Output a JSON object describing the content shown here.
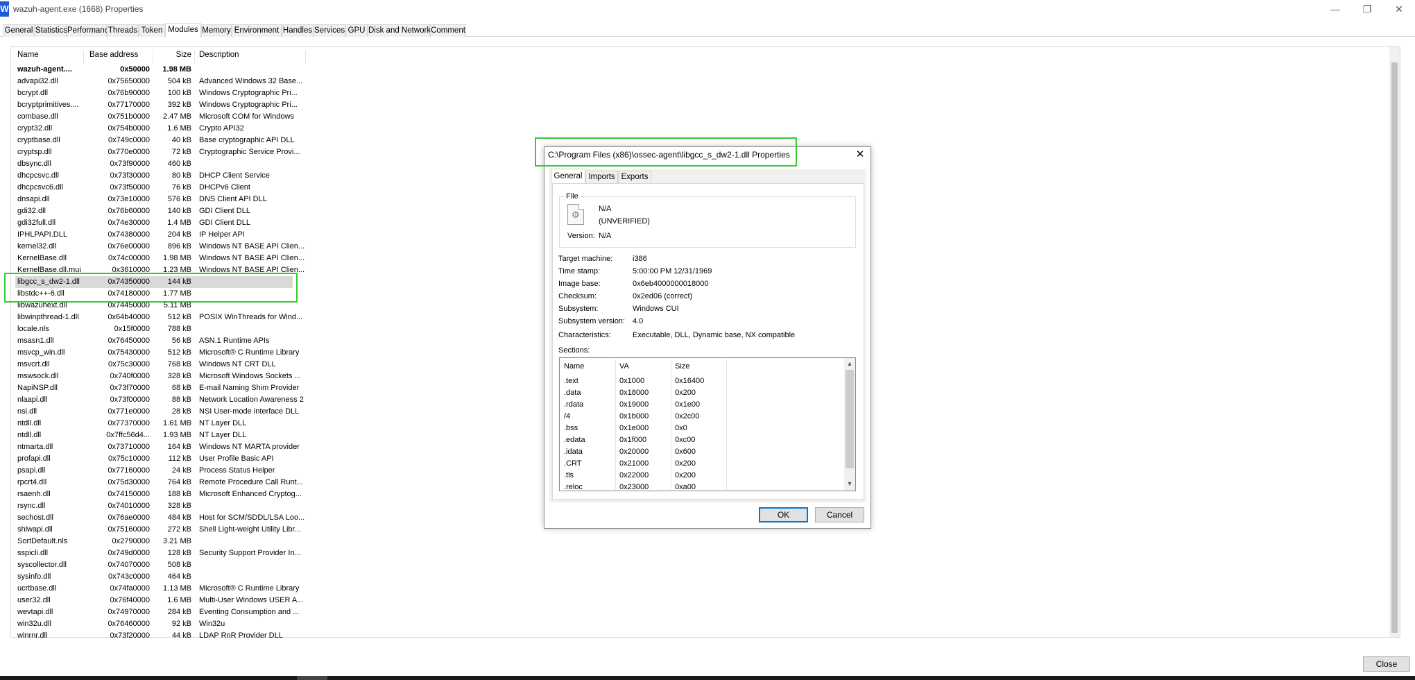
{
  "window": {
    "app_icon_letter": "W",
    "title": "wazuh-agent.exe (1668) Properties",
    "close_button": "Close"
  },
  "tabs": [
    "General",
    "Statistics",
    "Performance",
    "Threads",
    "Token",
    "Modules",
    "Memory",
    "Environment",
    "Handles",
    "Services",
    "GPU",
    "Disk and Network",
    "Comment"
  ],
  "active_tab": "Modules",
  "modules": {
    "columns": {
      "name": "Name",
      "base": "Base address",
      "size": "Size",
      "desc": "Description"
    },
    "rows": [
      {
        "name": "wazuh-agent....",
        "base": "0x50000",
        "size": "1.98 MB",
        "desc": "",
        "bold": true
      },
      {
        "name": "advapi32.dll",
        "base": "0x75650000",
        "size": "504 kB",
        "desc": "Advanced Windows 32 Base..."
      },
      {
        "name": "bcrypt.dll",
        "base": "0x76b90000",
        "size": "100 kB",
        "desc": "Windows Cryptographic Pri..."
      },
      {
        "name": "bcryptprimitives....",
        "base": "0x77170000",
        "size": "392 kB",
        "desc": "Windows Cryptographic Pri..."
      },
      {
        "name": "combase.dll",
        "base": "0x751b0000",
        "size": "2.47 MB",
        "desc": "Microsoft COM for Windows"
      },
      {
        "name": "crypt32.dll",
        "base": "0x754b0000",
        "size": "1.6 MB",
        "desc": "Crypto API32"
      },
      {
        "name": "cryptbase.dll",
        "base": "0x749c0000",
        "size": "40 kB",
        "desc": "Base cryptographic API DLL"
      },
      {
        "name": "cryptsp.dll",
        "base": "0x770e0000",
        "size": "72 kB",
        "desc": "Cryptographic Service Provi..."
      },
      {
        "name": "dbsync.dll",
        "base": "0x73f90000",
        "size": "460 kB",
        "desc": ""
      },
      {
        "name": "dhcpcsvc.dll",
        "base": "0x73f30000",
        "size": "80 kB",
        "desc": "DHCP Client Service"
      },
      {
        "name": "dhcpcsvc6.dll",
        "base": "0x73f50000",
        "size": "76 kB",
        "desc": "DHCPv6 Client"
      },
      {
        "name": "dnsapi.dll",
        "base": "0x73e10000",
        "size": "576 kB",
        "desc": "DNS Client API DLL"
      },
      {
        "name": "gdi32.dll",
        "base": "0x76b60000",
        "size": "140 kB",
        "desc": "GDI Client DLL"
      },
      {
        "name": "gdi32full.dll",
        "base": "0x74e30000",
        "size": "1.4 MB",
        "desc": "GDI Client DLL"
      },
      {
        "name": "IPHLPAPI.DLL",
        "base": "0x74380000",
        "size": "204 kB",
        "desc": "IP Helper API"
      },
      {
        "name": "kernel32.dll",
        "base": "0x76e00000",
        "size": "896 kB",
        "desc": "Windows NT BASE API Clien..."
      },
      {
        "name": "KernelBase.dll",
        "base": "0x74c00000",
        "size": "1.98 MB",
        "desc": "Windows NT BASE API Clien..."
      },
      {
        "name": "KernelBase.dll.mui",
        "base": "0x3610000",
        "size": "1.23 MB",
        "desc": "Windows NT BASE API Clien..."
      },
      {
        "name": "libgcc_s_dw2-1.dll",
        "base": "0x74350000",
        "size": "144 kB",
        "desc": "",
        "selected": true
      },
      {
        "name": "libstdc++-6.dll",
        "base": "0x74180000",
        "size": "1.77 MB",
        "desc": ""
      },
      {
        "name": "libwazuhext.dll",
        "base": "0x74450000",
        "size": "5.11 MB",
        "desc": ""
      },
      {
        "name": "libwinpthread-1.dll",
        "base": "0x64b40000",
        "size": "512 kB",
        "desc": "POSIX WinThreads for Wind..."
      },
      {
        "name": "locale.nls",
        "base": "0x15f0000",
        "size": "788 kB",
        "desc": ""
      },
      {
        "name": "msasn1.dll",
        "base": "0x76450000",
        "size": "56 kB",
        "desc": "ASN.1 Runtime APIs"
      },
      {
        "name": "msvcp_win.dll",
        "base": "0x75430000",
        "size": "512 kB",
        "desc": "Microsoft® C Runtime Library"
      },
      {
        "name": "msvcrt.dll",
        "base": "0x75c30000",
        "size": "768 kB",
        "desc": "Windows NT CRT DLL"
      },
      {
        "name": "mswsock.dll",
        "base": "0x740f0000",
        "size": "328 kB",
        "desc": "Microsoft Windows Sockets ..."
      },
      {
        "name": "NapiNSP.dll",
        "base": "0x73f70000",
        "size": "68 kB",
        "desc": "E-mail Naming Shim Provider"
      },
      {
        "name": "nlaapi.dll",
        "base": "0x73f00000",
        "size": "88 kB",
        "desc": "Network Location Awareness 2"
      },
      {
        "name": "nsi.dll",
        "base": "0x771e0000",
        "size": "28 kB",
        "desc": "NSI User-mode interface DLL"
      },
      {
        "name": "ntdll.dll",
        "base": "0x77370000",
        "size": "1.61 MB",
        "desc": "NT Layer DLL"
      },
      {
        "name": "ntdll.dll",
        "base": "0x7ffc56d4...",
        "size": "1.93 MB",
        "desc": "NT Layer DLL"
      },
      {
        "name": "ntmarta.dll",
        "base": "0x73710000",
        "size": "164 kB",
        "desc": "Windows NT MARTA provider"
      },
      {
        "name": "profapi.dll",
        "base": "0x75c10000",
        "size": "112 kB",
        "desc": "User Profile Basic API"
      },
      {
        "name": "psapi.dll",
        "base": "0x77160000",
        "size": "24 kB",
        "desc": "Process Status Helper"
      },
      {
        "name": "rpcrt4.dll",
        "base": "0x75d30000",
        "size": "764 kB",
        "desc": "Remote Procedure Call Runt..."
      },
      {
        "name": "rsaenh.dll",
        "base": "0x74150000",
        "size": "188 kB",
        "desc": "Microsoft Enhanced Cryptog..."
      },
      {
        "name": "rsync.dll",
        "base": "0x74010000",
        "size": "328 kB",
        "desc": ""
      },
      {
        "name": "sechost.dll",
        "base": "0x76ae0000",
        "size": "484 kB",
        "desc": "Host for SCM/SDDL/LSA Loo..."
      },
      {
        "name": "shlwapi.dll",
        "base": "0x75160000",
        "size": "272 kB",
        "desc": "Shell Light-weight Utility Libr..."
      },
      {
        "name": "SortDefault.nls",
        "base": "0x2790000",
        "size": "3.21 MB",
        "desc": ""
      },
      {
        "name": "sspicli.dll",
        "base": "0x749d0000",
        "size": "128 kB",
        "desc": "Security Support Provider In..."
      },
      {
        "name": "syscollector.dll",
        "base": "0x74070000",
        "size": "508 kB",
        "desc": ""
      },
      {
        "name": "sysinfo.dll",
        "base": "0x743c0000",
        "size": "464 kB",
        "desc": ""
      },
      {
        "name": "ucrtbase.dll",
        "base": "0x74fa0000",
        "size": "1.13 MB",
        "desc": "Microsoft® C Runtime Library"
      },
      {
        "name": "user32.dll",
        "base": "0x76f40000",
        "size": "1.6 MB",
        "desc": "Multi-User Windows USER A..."
      },
      {
        "name": "wevtapi.dll",
        "base": "0x74970000",
        "size": "284 kB",
        "desc": "Eventing Consumption and ..."
      },
      {
        "name": "win32u.dll",
        "base": "0x76460000",
        "size": "92 kB",
        "desc": "Win32u"
      },
      {
        "name": "winrnr.dll",
        "base": "0x73f20000",
        "size": "44 kB",
        "desc": "LDAP RnR Provider DLL"
      }
    ]
  },
  "dialog": {
    "title": "C:\\Program Files (x86)\\ossec-agent\\libgcc_s_dw2-1.dll Properties",
    "tabs": [
      "General",
      "Imports",
      "Exports"
    ],
    "active_tab": "General",
    "file": {
      "group_label": "File",
      "name": "N/A",
      "verification": "(UNVERIFIED)",
      "version_label": "Version:",
      "version_value": "N/A"
    },
    "props": [
      {
        "label": "Target machine:",
        "value": "i386"
      },
      {
        "label": "Time stamp:",
        "value": "5:00:00 PM 12/31/1969"
      },
      {
        "label": "Image base:",
        "value": "0x6eb4000000018000"
      },
      {
        "label": "Checksum:",
        "value": "0x2ed06 (correct)"
      },
      {
        "label": "Subsystem:",
        "value": "Windows CUI"
      },
      {
        "label": "Subsystem version:",
        "value": "4.0"
      },
      {
        "label": "Characteristics:",
        "value": "Executable, DLL, Dynamic base, NX compatible"
      }
    ],
    "sections_label": "Sections:",
    "sections_columns": {
      "name": "Name",
      "va": "VA",
      "size": "Size"
    },
    "sections": [
      {
        "name": ".text",
        "va": "0x1000",
        "size": "0x16400"
      },
      {
        "name": ".data",
        "va": "0x18000",
        "size": "0x200"
      },
      {
        "name": ".rdata",
        "va": "0x19000",
        "size": "0x1e00"
      },
      {
        "name": "/4",
        "va": "0x1b000",
        "size": "0x2c00"
      },
      {
        "name": ".bss",
        "va": "0x1e000",
        "size": "0x0"
      },
      {
        "name": ".edata",
        "va": "0x1f000",
        "size": "0xc00"
      },
      {
        "name": ".idata",
        "va": "0x20000",
        "size": "0x600"
      },
      {
        "name": ".CRT",
        "va": "0x21000",
        "size": "0x200"
      },
      {
        "name": ".tls",
        "va": "0x22000",
        "size": "0x200"
      },
      {
        "name": ".reloc",
        "va": "0x23000",
        "size": "0xa00"
      }
    ],
    "ok_label": "OK",
    "cancel_label": "Cancel",
    "close_glyph": "✕"
  },
  "icons": {
    "app": "wazuh-app-icon",
    "file": "dll-file-icon",
    "minimize": "minimize-icon",
    "restore": "restore-icon",
    "close": "close-icon"
  },
  "colors": {
    "highlight": "#33cc33",
    "selection": "#d9d9d9",
    "accent": "#0078d7"
  }
}
